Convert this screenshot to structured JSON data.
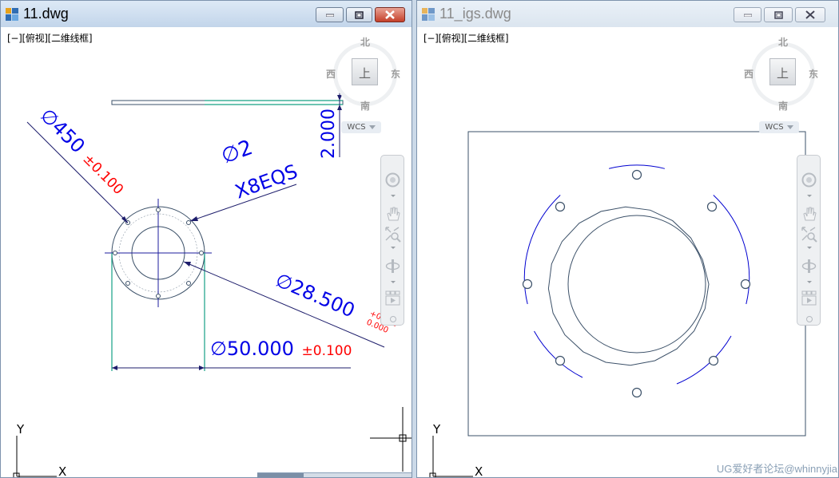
{
  "windows": {
    "left": {
      "title": "11.dwg",
      "view_label": "[−][俯视][二维线框]",
      "cube": {
        "north": "北",
        "south": "南",
        "east": "东",
        "west": "西",
        "face": "上"
      },
      "wcs_label": "WCS",
      "ucs": {
        "x": "X",
        "y": "Y"
      },
      "dimensions": {
        "d1_value": "∅450",
        "d1_tol": "±0.100",
        "hole_dia": "∅2",
        "hole_count": "X8EQS",
        "d2_value": "∅28.500",
        "d2_tol_upper": "+0.200",
        "d2_tol_lower": "0.000",
        "d3_value": "∅50.000",
        "d3_tol": "±0.100",
        "thickness": "2.000"
      }
    },
    "right": {
      "title": "11_igs.dwg",
      "view_label": "[−][俯视][二维线框]",
      "cube": {
        "north": "北",
        "south": "南",
        "east": "东",
        "west": "西",
        "face": "上"
      },
      "wcs_label": "WCS",
      "ucs": {
        "x": "X",
        "y": "Y"
      }
    }
  },
  "watermark": "UG爱好者论坛@whinnyjia",
  "colors": {
    "dimension_text": "#0000e6",
    "tolerance_text": "#ff0000",
    "geometry": "#3b5068",
    "dimension_line": "#1d1d6b",
    "extension_line": "#16a085"
  },
  "icons": {
    "app": "autocad-dwg-icon",
    "minimize": "minimize-icon",
    "maximize": "maximize-icon",
    "close": "close-icon",
    "pan": "pan-hand-icon",
    "zoom": "zoom-icon",
    "orbit": "orbit-icon",
    "steering": "steering-wheel-icon",
    "showmotion": "showmotion-icon"
  }
}
